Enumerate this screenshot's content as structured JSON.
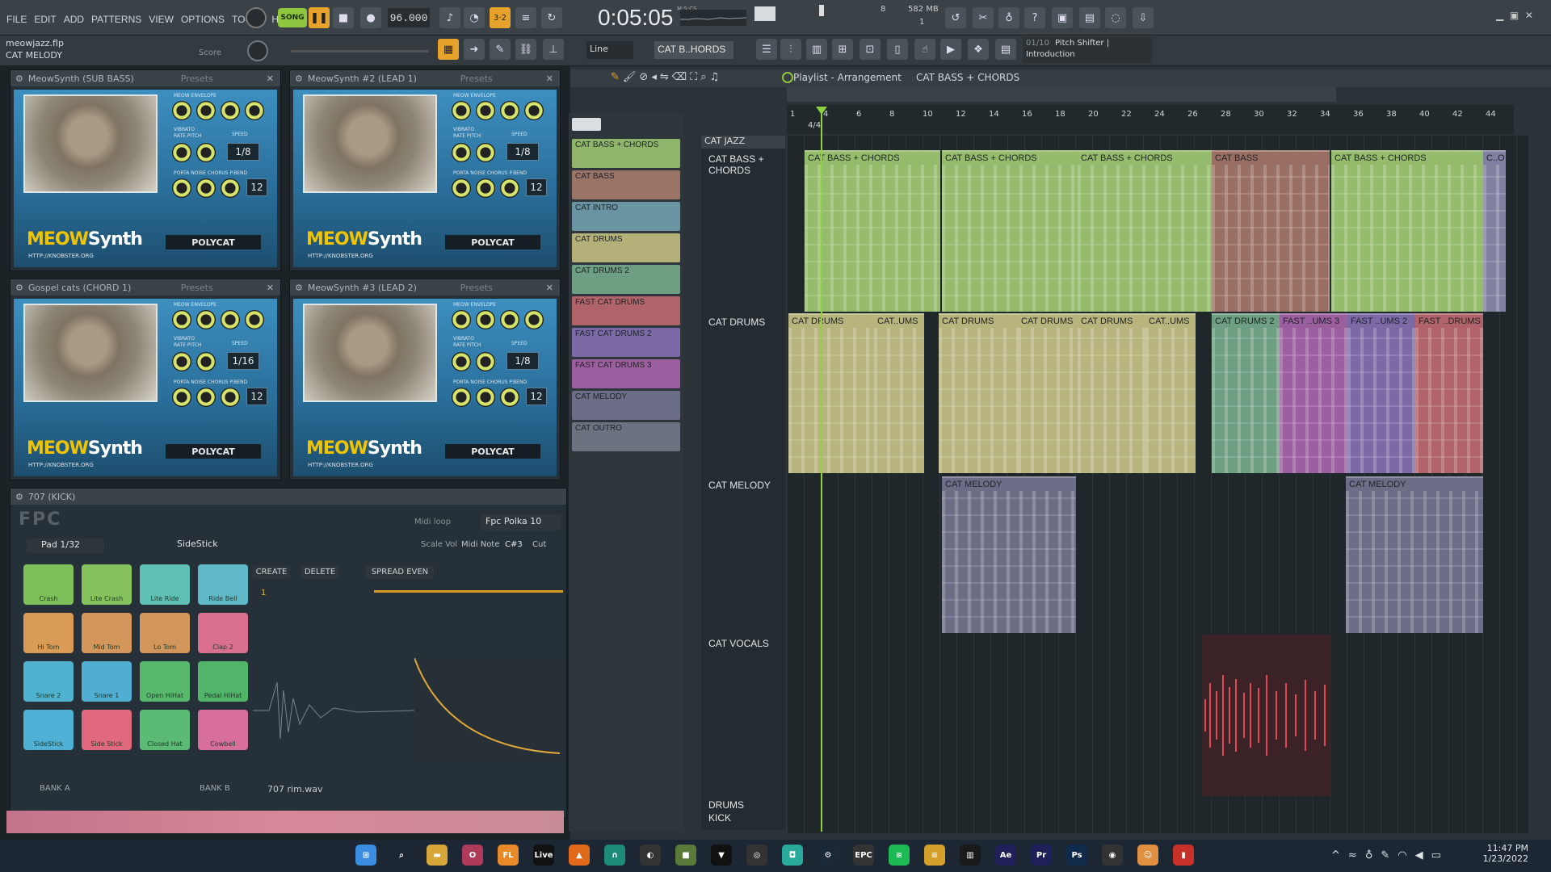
{
  "menu": [
    "FILE",
    "EDIT",
    "ADD",
    "PATTERNS",
    "VIEW",
    "OPTIONS",
    "TOOLS",
    "HELP"
  ],
  "transport": {
    "mode": "SONG",
    "tempo": "96.000",
    "time": "0:05:05",
    "time_unit": "M:S:CS",
    "memory": "582 MB",
    "counter_a": "8",
    "counter_b": "1"
  },
  "project": {
    "file": "meowjazz.flp",
    "hint": "CAT MELODY",
    "score_label": "Score"
  },
  "snap": {
    "value": "Line",
    "pattern": "CAT B..HORDS"
  },
  "hint_panel": {
    "count": "01/10",
    "title": "Pitch Shifter |",
    "subtitle": "Introduction"
  },
  "plugins": [
    {
      "name": "MeowSynth (SUB BASS)",
      "speed": "1/8",
      "chorus": "12",
      "presets": "Presets"
    },
    {
      "name": "MeowSynth #2 (LEAD 1)",
      "speed": "1/8",
      "chorus": "12",
      "presets": "Presets"
    },
    {
      "name": "Gospel cats (CHORD 1)",
      "speed": "1/16",
      "chorus": "12",
      "presets": "Presets"
    },
    {
      "name": "MeowSynth #3 (LEAD 2)",
      "speed": "1/8",
      "chorus": "12",
      "presets": "Presets"
    }
  ],
  "plugin_text": {
    "logo_a": "MEOW",
    "logo_b": "Synth",
    "polycat": "POLYCAT",
    "url": "HTTP://KNOBSTER.ORG",
    "envelope": "MEOW ENVELOPE",
    "vibrato": "VIBRATO",
    "speed": "SPEED",
    "porta": "PORTA  NOISE CHORUS P.BEND",
    "rate_pitch": "RATE PITCH"
  },
  "fpc": {
    "title": "707 (KICK)",
    "logo": "FPC",
    "midi_loop_label": "Midi loop",
    "preset": "Fpc Polka 10",
    "pad": "Pad 1/32",
    "pad_name": "SideStick",
    "create": "CREATE",
    "delete": "DELETE",
    "spread": "SPREAD EVEN",
    "midi_note": "Midi Note",
    "note": "C#3",
    "cut": "Cut",
    "scale": "Scale Vol",
    "sample": "707 rim.wav",
    "bank_a": "BANK A",
    "bank_b": "BANK B",
    "layer": "1",
    "pads": [
      {
        "name": "Crash",
        "color": "#7fbf5a"
      },
      {
        "name": "Lite Crash",
        "color": "#86c25c"
      },
      {
        "name": "Lite Ride",
        "color": "#5fc0b5"
      },
      {
        "name": "Ride Bell",
        "color": "#5fb8c8"
      },
      {
        "name": "Hi Tom",
        "color": "#d99b56"
      },
      {
        "name": "Mid Tom",
        "color": "#d4965a"
      },
      {
        "name": "Lo Tom",
        "color": "#d2955a"
      },
      {
        "name": "Clap 2",
        "color": "#d9708f"
      },
      {
        "name": "Snare 2",
        "color": "#4fb3d0"
      },
      {
        "name": "Snare 1",
        "color": "#4faed2"
      },
      {
        "name": "Open HiHat",
        "color": "#58b86c"
      },
      {
        "name": "Pedal HiHat",
        "color": "#52b469"
      },
      {
        "name": "SideStick",
        "color": "#4fb1d6"
      },
      {
        "name": "Side Stick",
        "color": "#e0697d"
      },
      {
        "name": "Closed Hat",
        "color": "#5bbb74"
      },
      {
        "name": "Cowbell",
        "color": "#d86f9b"
      }
    ]
  },
  "playlist": {
    "title": "Playlist - Arrangement",
    "crumb": "CAT BASS + CHORDS",
    "group": "CAT JAZZ",
    "ruler": [
      "1",
      "4",
      "6",
      "8",
      "10",
      "12",
      "14",
      "16",
      "18",
      "20",
      "22",
      "24",
      "26",
      "28",
      "30",
      "32",
      "34",
      "36",
      "38",
      "40",
      "42",
      "44"
    ],
    "patterns": [
      {
        "name": "CAT BASS + CHORDS",
        "color": "#8fb56a"
      },
      {
        "name": "CAT BASS",
        "color": "#9b7468"
      },
      {
        "name": "CAT INTRO",
        "color": "#6a94a2"
      },
      {
        "name": "CAT DRUMS",
        "color": "#b3b07a"
      },
      {
        "name": "CAT DRUMS 2",
        "color": "#6f9f82"
      },
      {
        "name": "FAST CAT DRUMS",
        "color": "#b0646a"
      },
      {
        "name": "FAST CAT DRUMS 2",
        "color": "#7b6aa6"
      },
      {
        "name": "FAST CAT DRUMS 3",
        "color": "#9b5e9e"
      },
      {
        "name": "CAT MELODY",
        "color": "#6c6d86"
      },
      {
        "name": "CAT OUTRO",
        "color": "#6d7280"
      }
    ],
    "tracks": [
      "CAT BASS + CHORDS",
      "CAT DRUMS",
      "CAT MELODY",
      "CAT VOCALS",
      "DRUMS",
      "KICK"
    ],
    "clips": {
      "row1": [
        "CAT BASS + CHORDS",
        "CAT BASS + CHORDS",
        "CAT BASS + CHORDS",
        "CAT BASS",
        "CAT BASS + CHORDS",
        "C..O"
      ],
      "row2": [
        "CAT DRUMS",
        "CAT..UMS",
        "CAT DRUMS",
        "CAT DRUMS",
        "CAT DRUMS",
        "CAT..UMS",
        "CAT DRUMS 2",
        "FAST ..UMS 3",
        "FAST ..UMS 2",
        "FAST ..DRUMS"
      ],
      "row3": [
        "CAT MELODY",
        "CAT MELODY"
      ]
    },
    "marker": "4/4"
  },
  "taskbar": {
    "time": "11:47 PM",
    "date": "1/23/2022"
  }
}
